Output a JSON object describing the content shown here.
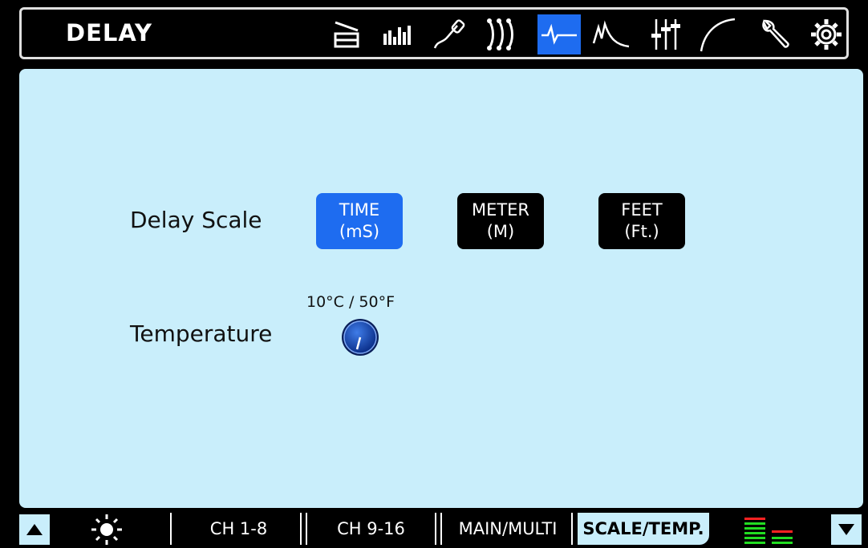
{
  "header": {
    "title": "DELAY",
    "icons": [
      "input-icon",
      "eq-bars-icon",
      "cable-icon",
      "routing-icon",
      "delay-icon",
      "compressor-icon",
      "faders-icon",
      "curve-icon",
      "wrench-icon",
      "settings-icon"
    ],
    "active_icon": "delay-icon"
  },
  "main": {
    "delay_scale": {
      "label": "Delay Scale",
      "options": [
        {
          "line1": "TIME",
          "line2": "(mS)",
          "active": true
        },
        {
          "line1": "METER",
          "line2": "(M)",
          "active": false
        },
        {
          "line1": "FEET",
          "line2": "(Ft.)",
          "active": false
        }
      ]
    },
    "temperature": {
      "label": "Temperature",
      "readout": "10°C / 50°F"
    }
  },
  "footer": {
    "tabs": [
      "CH 1-8",
      "CH 9-16",
      "MAIN/MULTI",
      "SCALE/TEMP."
    ],
    "active_tab": "SCALE/TEMP."
  },
  "colors": {
    "accent": "#1e6cf0",
    "panel": "#c9eefb",
    "meter_green": "#22dd22",
    "meter_red": "#ff2222"
  }
}
